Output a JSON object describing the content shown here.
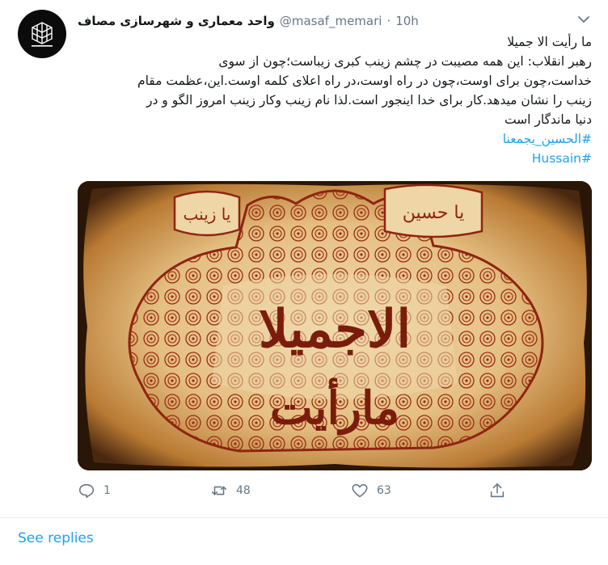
{
  "tweet": {
    "display_name": "واحد معماری و شهرسازی مصاف",
    "handle": "@masaf_memari",
    "separator": "·",
    "time": "10h",
    "lines": [
      "ما رأیت الا جمیلا",
      "رهبر انقلاب: این همه مصیبت در چشم زینب کبری زیباست؛چون از سوی",
      "خداست،چون برای اوست،چون در راه اوست،در راه اعلای کلمه اوست.این،عظمت مقام",
      "زینب را نشان میدهد.کار برای خدا اینجور است.لذا نام زینب وکار زینب امروز الگو و در",
      "دنیا ماندگار است"
    ],
    "hashtags": [
      "#الحسین_یجمعنا",
      "#Hussain"
    ],
    "media_alt": "ما رأیت الا جمیلا calligraphy artwork",
    "media_texts": {
      "main_word": "الاجميلا",
      "lower_word": "مارأيت",
      "cartouche_left": "يا زينب",
      "cartouche_right": "يا حسين"
    }
  },
  "actions": {
    "reply_count": "1",
    "retweet_count": "48",
    "like_count": "63"
  },
  "footer": {
    "see_replies": "See replies"
  },
  "colors": {
    "link": "#1da1f2",
    "secondary": "#657786",
    "text": "#14171a"
  }
}
